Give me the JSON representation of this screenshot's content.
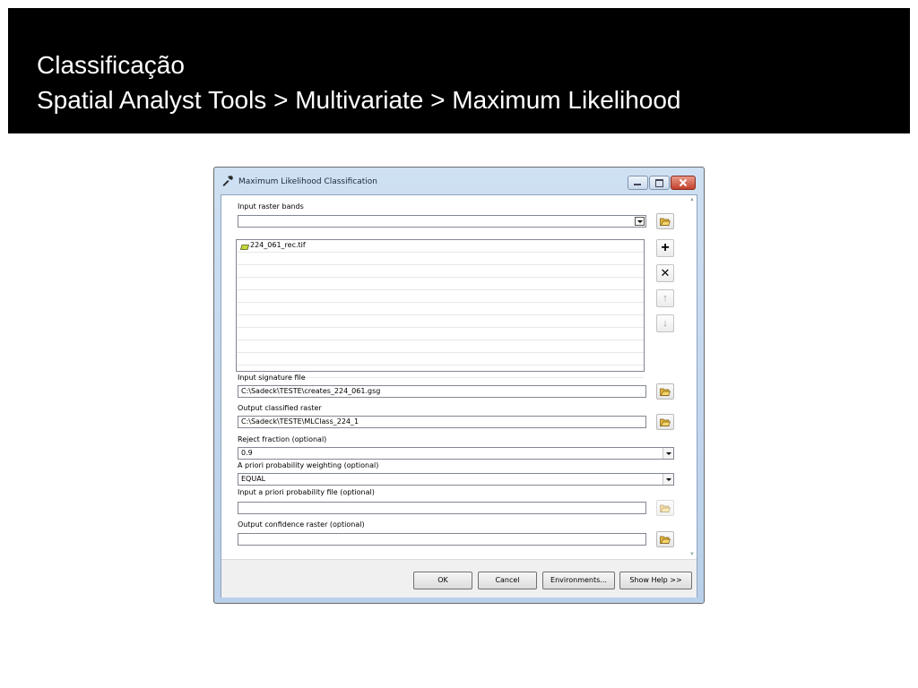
{
  "slide": {
    "title_line1": "Classificação",
    "title_line2": "Spatial Analyst Tools > Multivariate > Maximum Likelihood"
  },
  "dialog": {
    "title": "Maximum Likelihood Classification",
    "fields": {
      "input_raster_bands": {
        "label": "Input raster bands",
        "value": ""
      },
      "raster_list": [
        "224_061_rec.tif"
      ],
      "input_signature_file": {
        "label": "Input signature file",
        "value": "C:\\Sadeck\\TESTE\\creates_224_061.gsg"
      },
      "output_classified_raster": {
        "label": "Output classified raster",
        "value": "C:\\Sadeck\\TESTE\\MLClass_224_1"
      },
      "reject_fraction": {
        "label": "Reject fraction (optional)",
        "value": "0.9"
      },
      "a_priori_weighting": {
        "label": "A priori probability weighting (optional)",
        "value": "EQUAL"
      },
      "a_priori_file": {
        "label": "Input a priori probability file (optional)",
        "value": ""
      },
      "output_confidence_raster": {
        "label": "Output confidence raster (optional)",
        "value": ""
      }
    },
    "buttons": {
      "ok": "OK",
      "cancel": "Cancel",
      "environments": "Environments...",
      "show_help": "Show Help >>"
    },
    "icons": {
      "title": "hammer-icon",
      "browse": "open-folder-icon",
      "add": "plus-icon",
      "remove": "x-icon",
      "move_up": "arrow-up-icon",
      "move_down": "arrow-down-icon",
      "raster_item": "raster-layer-icon"
    },
    "colors": {
      "titlebar": "#c4d7ee",
      "close_button": "#c94a36",
      "folder_icon": "#e9b73d"
    }
  }
}
